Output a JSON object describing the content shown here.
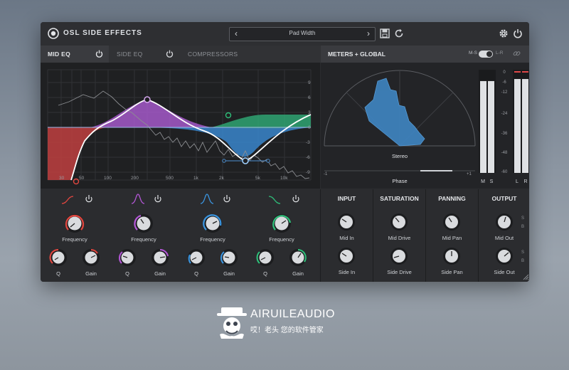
{
  "app": {
    "title": "OSL SIDE EFFECTS"
  },
  "preset": {
    "name": "Pad Width",
    "prev": "‹",
    "next": "›"
  },
  "tabs": {
    "mid_eq": "MID EQ",
    "side_eq": "SIDE EQ",
    "compressors": "COMPRESSORS",
    "meters_global": "METERS + GLOBAL"
  },
  "toggle": {
    "left": "M-S",
    "right": "L-R",
    "value": "L-R"
  },
  "eq": {
    "db_labels": [
      "9",
      "6",
      "3",
      "0",
      "-3",
      "-6",
      "-9"
    ],
    "freq_labels": [
      "30",
      "50",
      "100",
      "200",
      "500",
      "1k",
      "2k",
      "5k",
      "10k"
    ],
    "band_colors": [
      "#e0463f",
      "#b357d6",
      "#3a95e0",
      "#2fbf7a"
    ]
  },
  "meters": {
    "scale": [
      "0",
      "-6",
      "-12",
      "-24",
      "-36",
      "-48",
      "-60"
    ],
    "labels": [
      "M",
      "S",
      "L",
      "R"
    ],
    "levels": [
      0.89,
      0.89,
      0.91,
      0.91
    ],
    "goniometer_label": "Stereo",
    "phase_label": "Phase",
    "phase_min": "-1",
    "phase_max": "+1"
  },
  "bands": [
    {
      "freq": "Frequency",
      "q": "Q",
      "gain": "Gain"
    },
    {
      "freq": "Frequency",
      "q": "Q",
      "gain": "Gain"
    },
    {
      "freq": "Frequency",
      "q": "Q",
      "gain": "Gain"
    },
    {
      "freq": "Frequency",
      "q": "Q",
      "gain": "Gain"
    }
  ],
  "sections": {
    "input": {
      "title": "INPUT",
      "k1": "Mid In",
      "k2": "Side In"
    },
    "saturation": {
      "title": "SATURATION",
      "k1": "Mid Drive",
      "k2": "Side Drive"
    },
    "panning": {
      "title": "PANNING",
      "k1": "Mid Pan",
      "k2": "Side Pan"
    },
    "output": {
      "title": "OUTPUT",
      "k1": "Mid Out",
      "k2": "Side Out",
      "s": "S",
      "b": "B"
    }
  },
  "watermark": {
    "title": "AIRUILEAUDIO",
    "subtitle": "哎！老头 您的软件管家"
  }
}
